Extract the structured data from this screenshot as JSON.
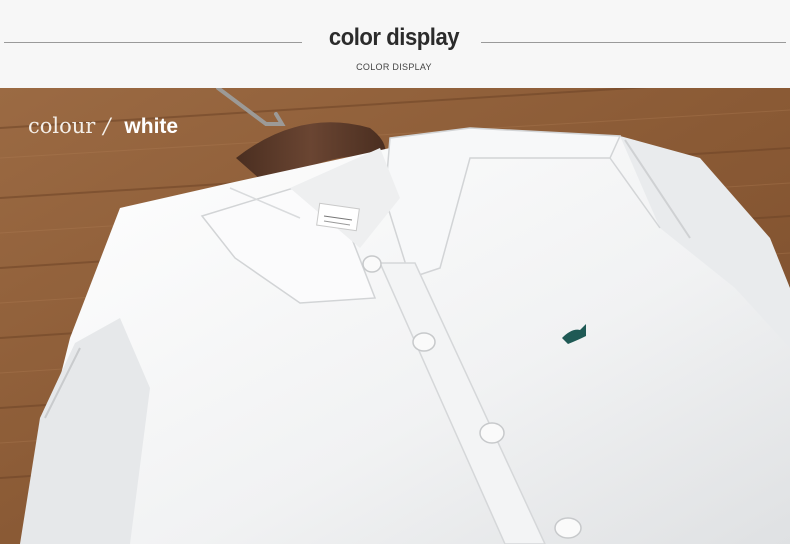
{
  "header": {
    "title": "color display",
    "subtitle": "COLOR DISPLAY"
  },
  "caption": {
    "label": "colour",
    "separator": "/",
    "value": "white"
  },
  "colors": {
    "wood": "#8a5a35",
    "shirt": "#f2f3f4",
    "hanger": "#5a3a2a",
    "logo": "#1f5a55"
  },
  "icons": {
    "logo": "embroidered-fish-logo-icon"
  }
}
